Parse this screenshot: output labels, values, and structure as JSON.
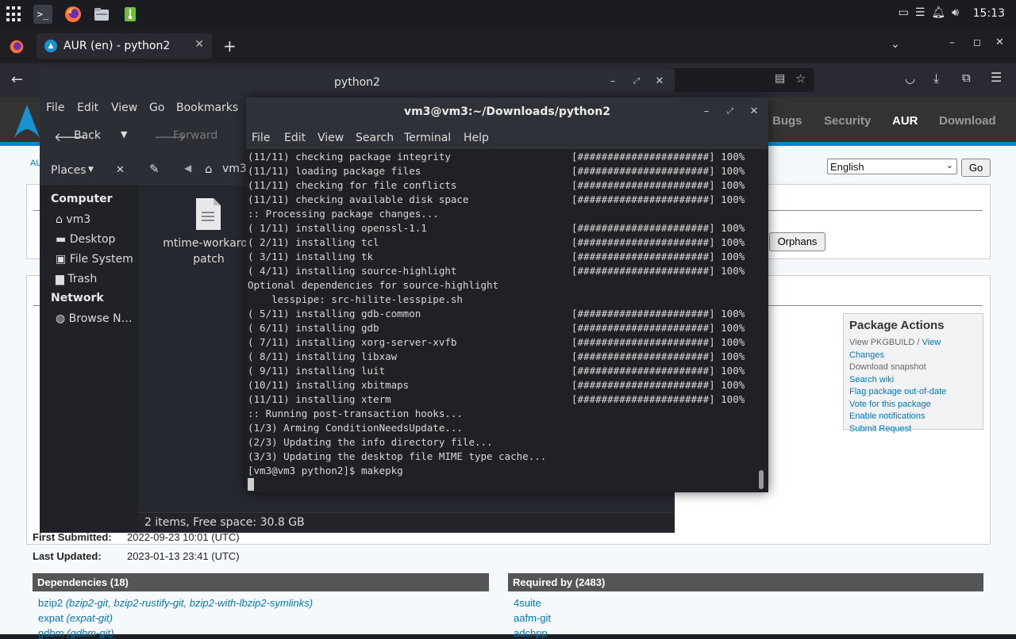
{
  "system_panel": {
    "clock": "15:13"
  },
  "browser": {
    "tab_title": "AUR (en) - python2",
    "new_tab": "+"
  },
  "aur": {
    "nav": [
      "Bugs",
      "Security",
      "AUR",
      "Download"
    ],
    "language_selected": "English",
    "go_button": "Go",
    "orphans_button": "Orphans",
    "breadcrumb_fragment": "AU",
    "first_submitted_label": "First Submitted:",
    "first_submitted_value": "2022-09-23 10:01 (UTC)",
    "last_updated_label": "Last Updated:",
    "last_updated_value": "2023-01-13 23:41 (UTC)",
    "dependencies_header": "Dependencies (18)",
    "required_by_header": "Required by (2483)",
    "dependencies": [
      {
        "name": "bzip2",
        "alts": "(bzip2-git, bzip2-rustify-git, bzip2-with-lbzip2-symlinks)"
      },
      {
        "name": "expat",
        "alts": "(expat-git)"
      },
      {
        "name": "gdbm",
        "alts": "(gdbm-git)"
      }
    ],
    "required_by": [
      "4suite",
      "aafm-git",
      "adchpp"
    ],
    "package_actions": {
      "title": "Package Actions",
      "view_pkgbuild": "View PKGBUILD",
      "separator": " / ",
      "view_changes": "View Changes",
      "download_snapshot": "Download snapshot",
      "search_wiki": "Search wiki",
      "flag": "Flag package out-of-date",
      "vote": "Vote for this package",
      "notifications": "Enable notifications",
      "submit_request": "Submit Request"
    }
  },
  "file_manager": {
    "title": "python2",
    "menu": [
      "File",
      "Edit",
      "View",
      "Go",
      "Bookmarks"
    ],
    "back": "Back",
    "forward": "Forward",
    "places": "Places",
    "path_segment": "vm3",
    "sidebar": {
      "computer_heading": "Computer",
      "computer_items": [
        "vm3",
        "Desktop",
        "File System",
        "Trash"
      ],
      "network_heading": "Network",
      "network_items": [
        "Browse N…"
      ]
    },
    "file_name_line1": "mtime-workarou",
    "file_name_line2": "patch",
    "status": "2 items, Free space: 30.8 GB"
  },
  "terminal": {
    "title": "vm3@vm3:~/Downloads/python2",
    "menu": [
      "File",
      "Edit",
      "View",
      "Search",
      "Terminal",
      "Help"
    ],
    "lines": [
      {
        "text": "(11/11) checking package integrity",
        "bar": "[######################] 100%"
      },
      {
        "text": "(11/11) loading package files",
        "bar": "[######################] 100%"
      },
      {
        "text": "(11/11) checking for file conflicts",
        "bar": "[######################] 100%"
      },
      {
        "text": "(11/11) checking available disk space",
        "bar": "[######################] 100%"
      },
      {
        "text": ":: Processing package changes...",
        "bar": ""
      },
      {
        "text": "( 1/11) installing openssl-1.1",
        "bar": "[######################] 100%"
      },
      {
        "text": "( 2/11) installing tcl",
        "bar": "[######################] 100%"
      },
      {
        "text": "( 3/11) installing tk",
        "bar": "[######################] 100%"
      },
      {
        "text": "( 4/11) installing source-highlight",
        "bar": "[######################] 100%"
      },
      {
        "text": "Optional dependencies for source-highlight",
        "bar": ""
      },
      {
        "text": "    lesspipe: src-hilite-lesspipe.sh",
        "bar": ""
      },
      {
        "text": "( 5/11) installing gdb-common",
        "bar": "[######################] 100%"
      },
      {
        "text": "( 6/11) installing gdb",
        "bar": "[######################] 100%"
      },
      {
        "text": "( 7/11) installing xorg-server-xvfb",
        "bar": "[######################] 100%"
      },
      {
        "text": "( 8/11) installing libxaw",
        "bar": "[######################] 100%"
      },
      {
        "text": "( 9/11) installing luit",
        "bar": "[######################] 100%"
      },
      {
        "text": "(10/11) installing xbitmaps",
        "bar": "[######################] 100%"
      },
      {
        "text": "(11/11) installing xterm",
        "bar": "[######################] 100%"
      },
      {
        "text": ":: Running post-transaction hooks...",
        "bar": ""
      },
      {
        "text": "(1/3) Arming ConditionNeedsUpdate...",
        "bar": ""
      },
      {
        "text": "(2/3) Updating the info directory file...",
        "bar": ""
      },
      {
        "text": "(3/3) Updating the desktop file MIME type cache...",
        "bar": ""
      },
      {
        "text": "[vm3@vm3 python2]$ makepkg",
        "bar": ""
      }
    ]
  }
}
